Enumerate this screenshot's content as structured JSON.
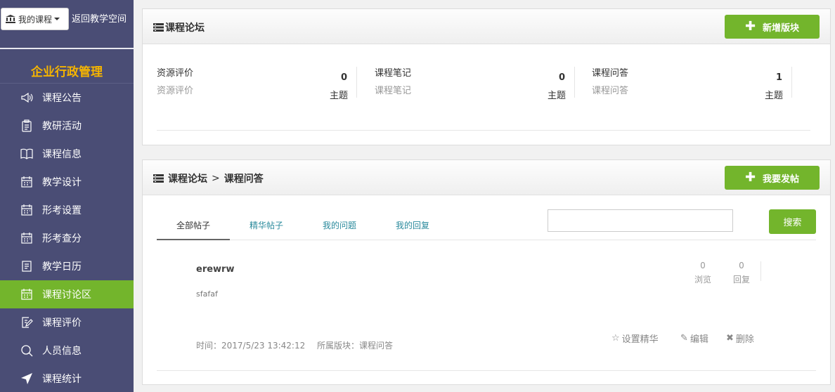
{
  "header": {
    "my_courses_label": "我的课程",
    "back_label": "返回教学空间"
  },
  "sidebar": {
    "course_title": "企业行政管理",
    "items": [
      {
        "label": "课程公告",
        "icon": "megaphone-icon"
      },
      {
        "label": "教研活动",
        "icon": "clipboard-icon"
      },
      {
        "label": "课程信息",
        "icon": "book-icon"
      },
      {
        "label": "教学设计",
        "icon": "calendar-icon"
      },
      {
        "label": "形考设置",
        "icon": "calendar-icon"
      },
      {
        "label": "形考查分",
        "icon": "calendar-icon"
      },
      {
        "label": "教学日历",
        "icon": "list-doc-icon"
      },
      {
        "label": "课程讨论区",
        "icon": "calendar-icon",
        "active": true
      },
      {
        "label": "课程评价",
        "icon": "edit-doc-icon"
      },
      {
        "label": "人员信息",
        "icon": "search-icon"
      },
      {
        "label": "课程统计",
        "icon": "navigation-arrow-icon"
      }
    ]
  },
  "forum": {
    "title": "课程论坛",
    "new_section_label": "新增版块",
    "sections": [
      {
        "name": "资源评价",
        "desc": "资源评价",
        "count": "0",
        "count_label": "主题"
      },
      {
        "name": "课程笔记",
        "desc": "课程笔记",
        "count": "0",
        "count_label": "主题"
      },
      {
        "name": "课程问答",
        "desc": "课程问答",
        "count": "1",
        "count_label": "主题"
      }
    ]
  },
  "board": {
    "breadcrumb_root": "课程论坛",
    "breadcrumb_sep": ">",
    "breadcrumb_current": "课程问答",
    "new_post_label": "我要发帖",
    "tabs": [
      "全部帖子",
      "精华帖子",
      "我的问题",
      "我的回复"
    ],
    "active_tab": 0,
    "search_value": "",
    "search_label": "搜索",
    "posts": [
      {
        "title": "erewrw",
        "body": "sfafaf",
        "views": "0",
        "views_label": "浏览",
        "replies": "0",
        "replies_label": "回复",
        "time": "时间：2017/5/23 13:42:12",
        "board": "所属版块：课程问答",
        "actions": [
          "设置精华",
          "编辑",
          "删除"
        ]
      }
    ]
  },
  "colors": {
    "sidebar_bg": "#4a4d75",
    "accent_green": "#73b52c",
    "course_title": "#f5b400",
    "tab_link": "#2a8a9c"
  }
}
